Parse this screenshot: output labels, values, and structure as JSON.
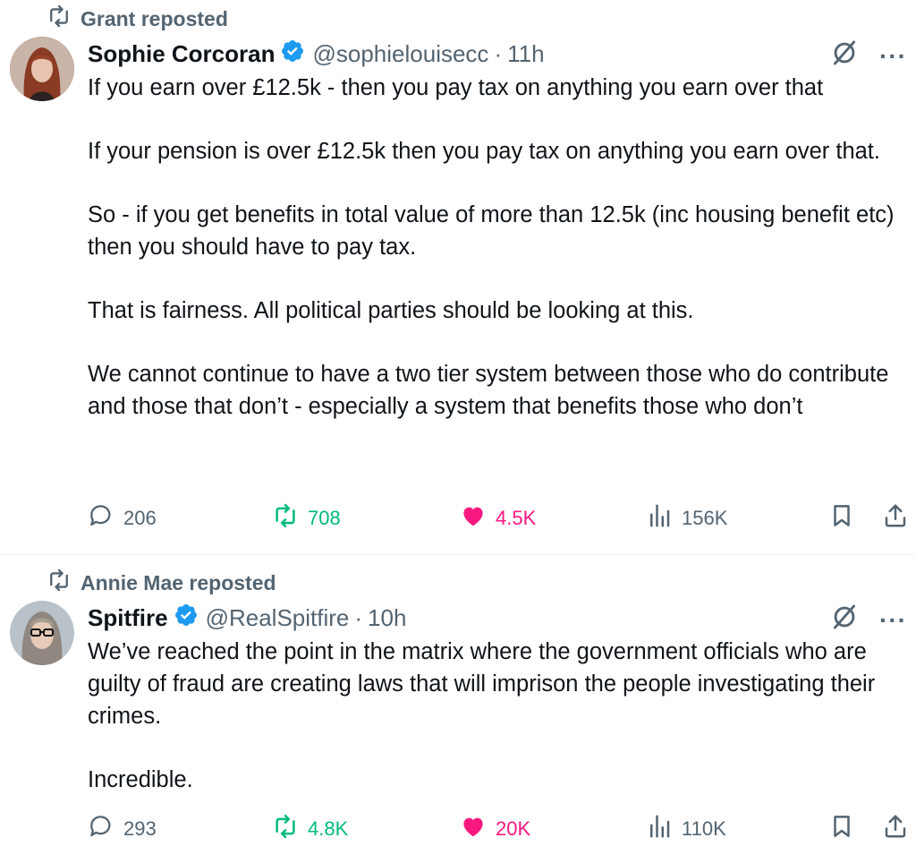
{
  "tweets": [
    {
      "reposted_by": "Grant reposted",
      "name": "Sophie Corcoran",
      "handle": "@sophielouisecc",
      "separator": "·",
      "time": "11h",
      "paragraphs": [
        "If you earn over £12.5k - then you pay tax on anything you earn over that",
        "If your pension is over £12.5k then you pay tax on anything you earn over that.",
        "So - if you get benefits in total value of more than 12.5k (inc housing benefit etc) then you should have to pay tax.",
        "That is fairness. All political parties should be looking at this.",
        "We cannot continue to have a two tier system between those who do contribute and those that don’t - especially a system that benefits those who don’t"
      ],
      "replies": "206",
      "reposts": "708",
      "likes": "4.5K",
      "views": "156K"
    },
    {
      "reposted_by": "Annie Mae reposted",
      "name": "Spitfire",
      "handle": "@RealSpitfire",
      "separator": "·",
      "time": "10h",
      "paragraphs": [
        "We’ve reached the point in the matrix where the government officials who are guilty of fraud are creating laws that will imprison the people investigating their crimes.",
        "Incredible."
      ],
      "replies": "293",
      "reposts": "4.8K",
      "likes": "20K",
      "views": "110K"
    }
  ],
  "icons": {
    "repost": "repost-icon",
    "verified": "verified-badge-icon",
    "grok": "grok-icon",
    "more": "more-icon",
    "reply": "reply-icon",
    "like": "heart-icon",
    "views": "views-icon",
    "bookmark": "bookmark-icon",
    "share": "share-icon"
  },
  "colors": {
    "text": "#0f1419",
    "secondary": "#536471",
    "repost_active": "#00ba7c",
    "like_active": "#f91880",
    "verified": "#1d9bf0"
  }
}
